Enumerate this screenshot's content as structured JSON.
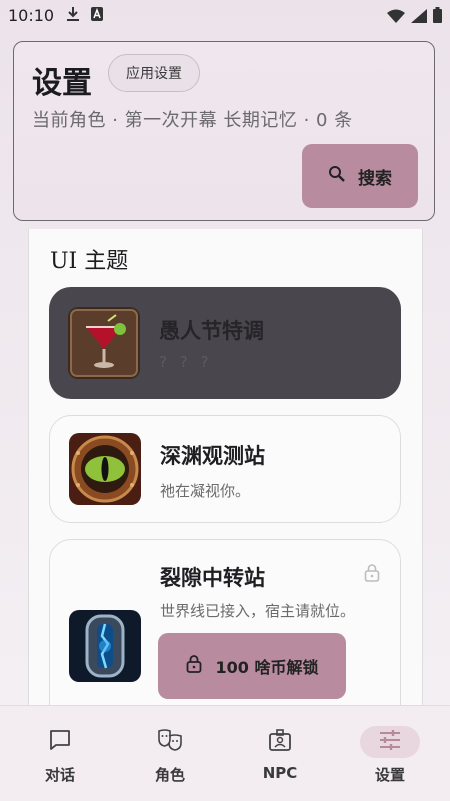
{
  "status_bar": {
    "time": "10:10",
    "icons": [
      "download-icon",
      "a-box-icon",
      "wifi-icon",
      "signal-icon",
      "battery-icon"
    ]
  },
  "header": {
    "title": "设置",
    "chip_label": "应用设置",
    "subtitle": "当前角色 · 第一次开幕    长期记忆 · 0 条",
    "search_label": "搜索"
  },
  "themes": {
    "section_title": "UI 主题",
    "items": [
      {
        "name": "愚人节特调",
        "desc": "? ? ?",
        "image": "cocktail-image",
        "selected": true
      },
      {
        "name": "深渊观测站",
        "desc": "祂在凝视你。",
        "image": "eye-porthole-image",
        "selected": false
      },
      {
        "name": "裂隙中转站",
        "desc": "世界线已接入，宿主请就位。",
        "image": "rift-portal-image",
        "selected": false,
        "locked": true,
        "unlock_label": "100 啥币解锁"
      }
    ]
  },
  "nav": {
    "items": [
      {
        "label": "对话",
        "icon": "chat-icon"
      },
      {
        "label": "角色",
        "icon": "masks-icon"
      },
      {
        "label": "NPC",
        "icon": "badge-icon"
      },
      {
        "label": "设置",
        "icon": "sliders-icon",
        "active": true
      }
    ]
  },
  "colors": {
    "accent": "#b88c9e",
    "selected_card": "#49474d",
    "nav_active": "#e9d7df"
  }
}
